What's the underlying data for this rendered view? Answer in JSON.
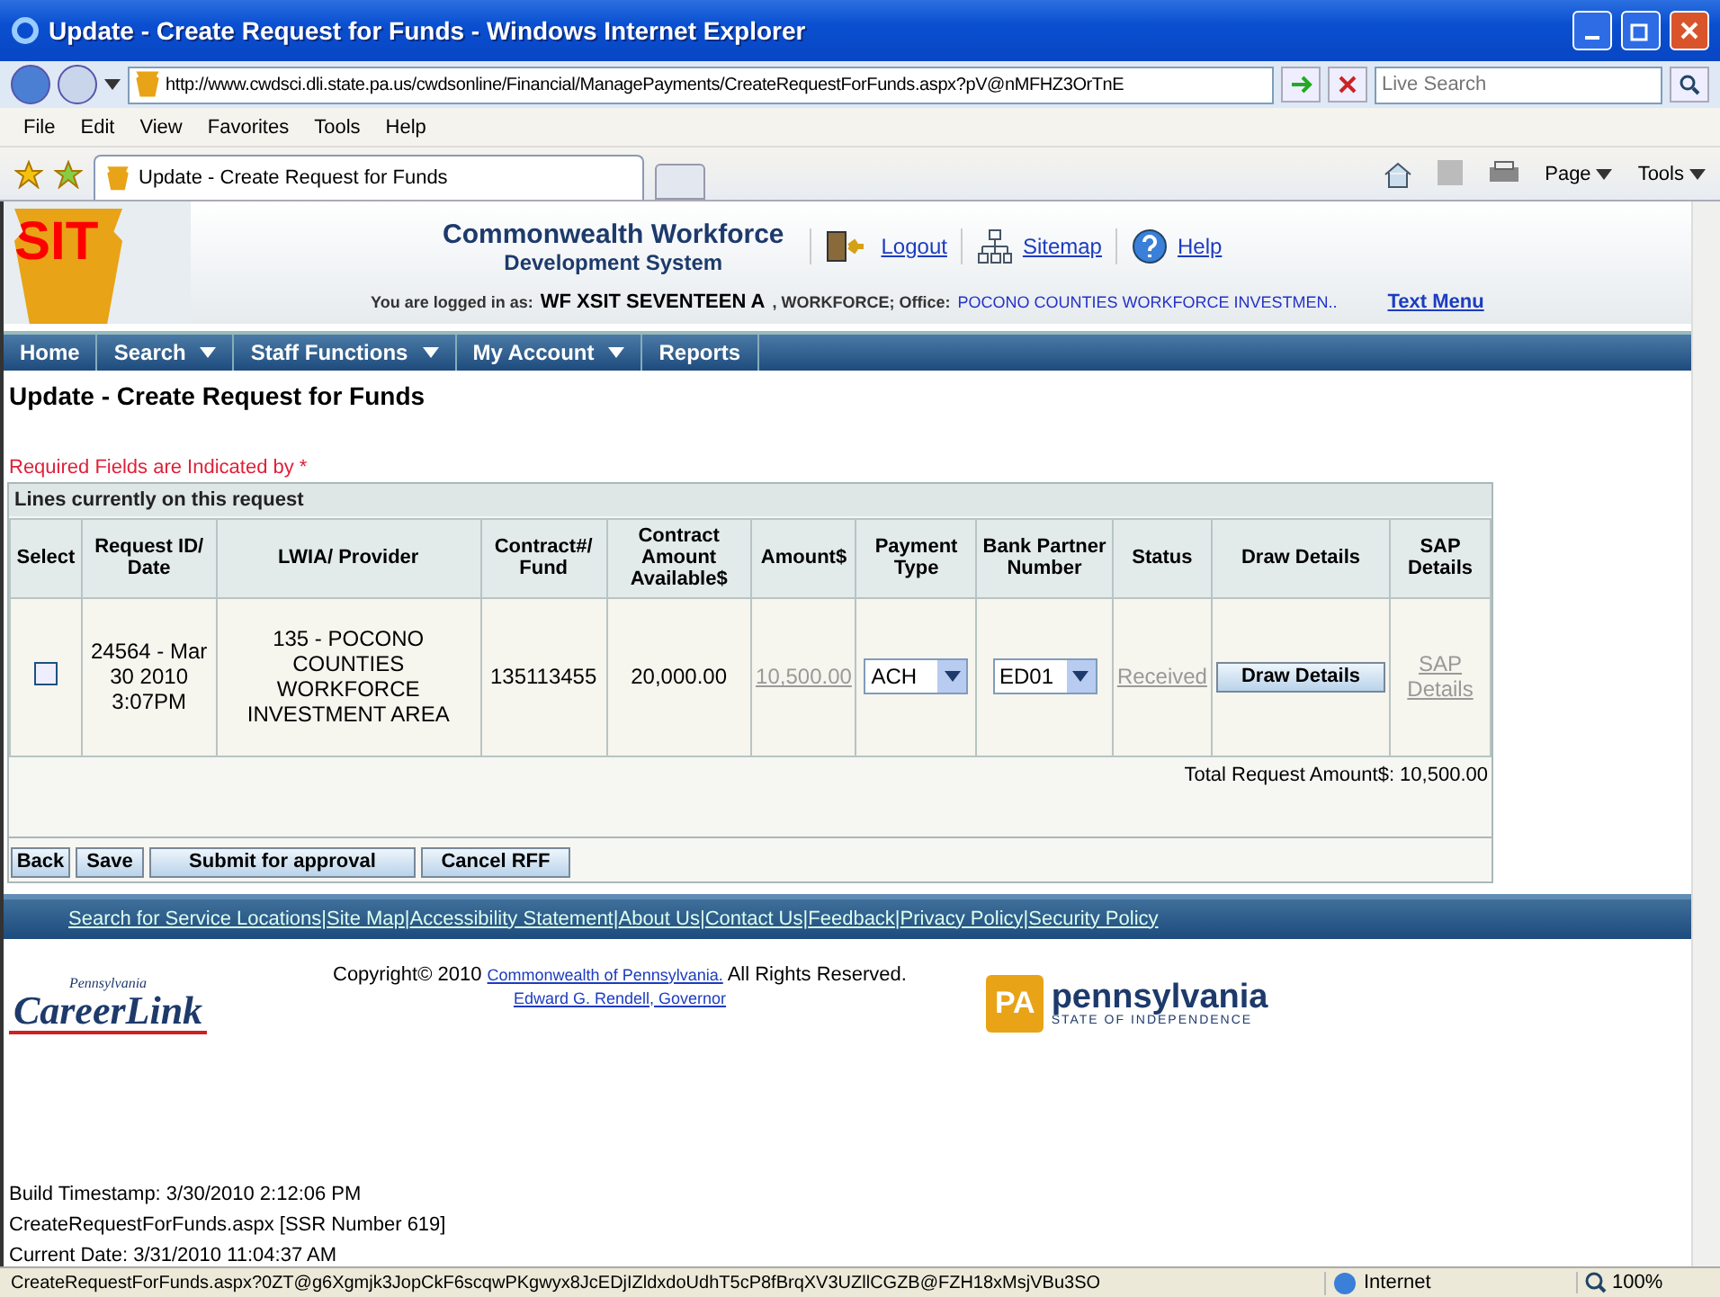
{
  "window": {
    "title": "Update - Create Request for Funds - Windows Internet Explorer"
  },
  "address_bar": {
    "url": "http://www.cwdsci.dli.state.pa.us/cwdsonline/Financial/ManagePayments/CreateRequestForFunds.aspx?pV@nMFHZ3OrTnE",
    "search_placeholder": "Live Search"
  },
  "menu_bar": [
    "File",
    "Edit",
    "View",
    "Favorites",
    "Tools",
    "Help"
  ],
  "tabs": [
    {
      "label": "Update - Create Request for Funds",
      "selected": true
    }
  ],
  "command_bar": {
    "page": "Page",
    "tools": "Tools"
  },
  "header": {
    "logo_text": "SIT",
    "title_line_1": "Commonwealth Workforce",
    "title_line_2": "Development System",
    "links": [
      {
        "kind": "logout",
        "label": "Logout"
      },
      {
        "kind": "sitemap",
        "label": "Sitemap"
      },
      {
        "kind": "help",
        "label": "Help"
      }
    ],
    "login_label": "You are logged in as:",
    "user": "WF XSIT SEVENTEEN A",
    "role": ", WORKFORCE; Office:",
    "office": "POCONO COUNTIES WORKFORCE INVESTMEN..",
    "text_menu": "Text Menu"
  },
  "nav": [
    {
      "label": "Home",
      "dropdown": false
    },
    {
      "label": "Search",
      "dropdown": true
    },
    {
      "label": "Staff Functions",
      "dropdown": true
    },
    {
      "label": "My Account",
      "dropdown": true
    },
    {
      "label": "Reports",
      "dropdown": false
    }
  ],
  "page_title": "Update - Create Request for Funds",
  "required_note": "Required Fields are Indicated by *",
  "table": {
    "caption": "Lines currently on this request",
    "columns": [
      "Select",
      "Request ID/ Date",
      "LWIA/ Provider",
      "Contract#/ Fund",
      "Contract Amount Available$",
      "Amount$",
      "Payment Type",
      "Bank Partner Number",
      "Status",
      "Draw Details",
      "SAP Details"
    ],
    "rows": [
      {
        "checked": false,
        "request": "24564 - Mar 30 2010 3:07PM",
        "provider": "135 - POCONO COUNTIES WORKFORCE INVESTMENT AREA",
        "contract": "135113455",
        "available": "20,000.00",
        "amount": "10,500.00",
        "payment_type": "ACH",
        "bank_partner": "ED01",
        "status": "Received",
        "draw_button": "Draw Details",
        "sap": "SAP Details",
        "disabled": true
      }
    ],
    "total": "Total Request Amount$: 10,500.00"
  },
  "buttons": [
    "Back",
    "Save",
    "Submit for approval",
    "Cancel RFF"
  ],
  "footer_links": [
    "Search for Service Locations|",
    "Site Map|",
    "Accessibility Statement|",
    "About Us|",
    "Contact Us|",
    "Feedback|",
    "Privacy Policy|",
    "Security Policy"
  ],
  "careerlink": {
    "small": "Pennsylvania",
    "big": "CareerLink"
  },
  "copyright": {
    "before": "Copyright© 2010",
    "link": "Commonwealth of Pennsylvania.",
    "after": "All Rights Reserved.",
    "governor": "Edward G. Rendell, Governor"
  },
  "pa_logo": {
    "mark": "PA",
    "name": "pennsylvania",
    "tagline": "STATE OF INDEPENDENCE"
  },
  "build_info": [
    "Build Timestamp: 3/30/2010 2:12:06 PM",
    "CreateRequestForFunds.aspx [SSR Number 619]",
    "Current Date: 3/31/2010 11:04:37 AM"
  ],
  "status_bar": {
    "url": "CreateRequestForFunds.aspx?0ZT@g6Xgmjk3JopCkF6scqwPKgwyx8JcEDjIZldxdoUdhT5cP8fBrqXV3UZllCGZB@FZH18xMsjVBu3SO",
    "zone": "Internet",
    "zoom": "100%"
  }
}
